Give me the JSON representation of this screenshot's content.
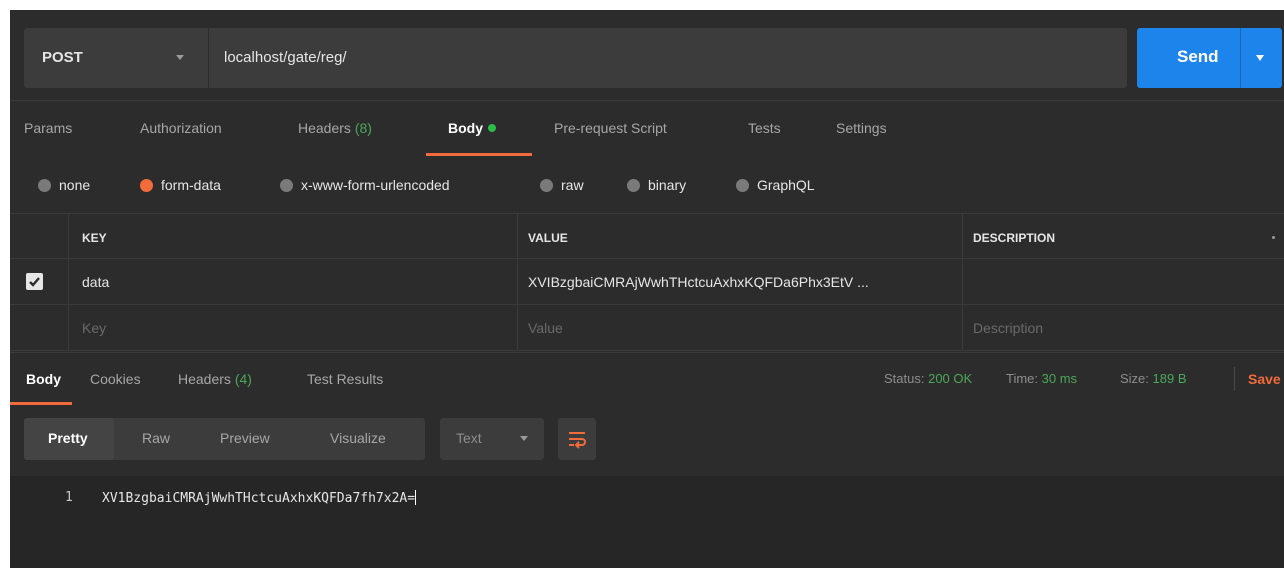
{
  "request": {
    "method": "POST",
    "url": "localhost/gate/reg/",
    "send_label": "Send"
  },
  "request_tabs": [
    {
      "label": "Params"
    },
    {
      "label": "Authorization"
    },
    {
      "label": "Headers",
      "count": "(8)"
    },
    {
      "label": "Body",
      "active": true
    },
    {
      "label": "Pre-request Script"
    },
    {
      "label": "Tests"
    },
    {
      "label": "Settings"
    }
  ],
  "body_types": [
    {
      "label": "none",
      "selected": false
    },
    {
      "label": "form-data",
      "selected": true
    },
    {
      "label": "x-www-form-urlencoded",
      "selected": false
    },
    {
      "label": "raw",
      "selected": false
    },
    {
      "label": "binary",
      "selected": false
    },
    {
      "label": "GraphQL",
      "selected": false
    }
  ],
  "params_table": {
    "headers": {
      "key": "KEY",
      "value": "VALUE",
      "description": "DESCRIPTION"
    },
    "rows": [
      {
        "checked": true,
        "key": "data",
        "value": "XVIBzgbaiCMRAjWwhTHctcuAxhxKQFDa6Phx3EtV ...",
        "description": ""
      }
    ],
    "placeholders": {
      "key": "Key",
      "value": "Value",
      "description": "Description"
    }
  },
  "response_tabs": [
    {
      "label": "Body",
      "active": true
    },
    {
      "label": "Cookies"
    },
    {
      "label": "Headers",
      "count": "(4)"
    },
    {
      "label": "Test Results"
    }
  ],
  "response_status": {
    "status_label": "Status:",
    "status_value": "200 OK",
    "time_label": "Time:",
    "time_value": "30 ms",
    "size_label": "Size:",
    "size_value": "189 B",
    "save_label": "Save"
  },
  "view_modes": [
    {
      "label": "Pretty",
      "active": true
    },
    {
      "label": "Raw"
    },
    {
      "label": "Preview"
    },
    {
      "label": "Visualize"
    }
  ],
  "format_select": {
    "value": "Text"
  },
  "response_body": {
    "lines": [
      {
        "number": "1",
        "text": "XV1BzgbaiCMRAjWwhTHctcuAxhxKQFDa7fh7x2A="
      }
    ]
  },
  "colors": {
    "accent": "#f26b3a",
    "send": "#1c84ea",
    "success": "#4ca75a",
    "background": "#2c2c2c"
  },
  "icons": [
    "chevron-down-icon",
    "checkbox-checked-icon",
    "wrap-lines-icon",
    "status-dot-icon"
  ]
}
